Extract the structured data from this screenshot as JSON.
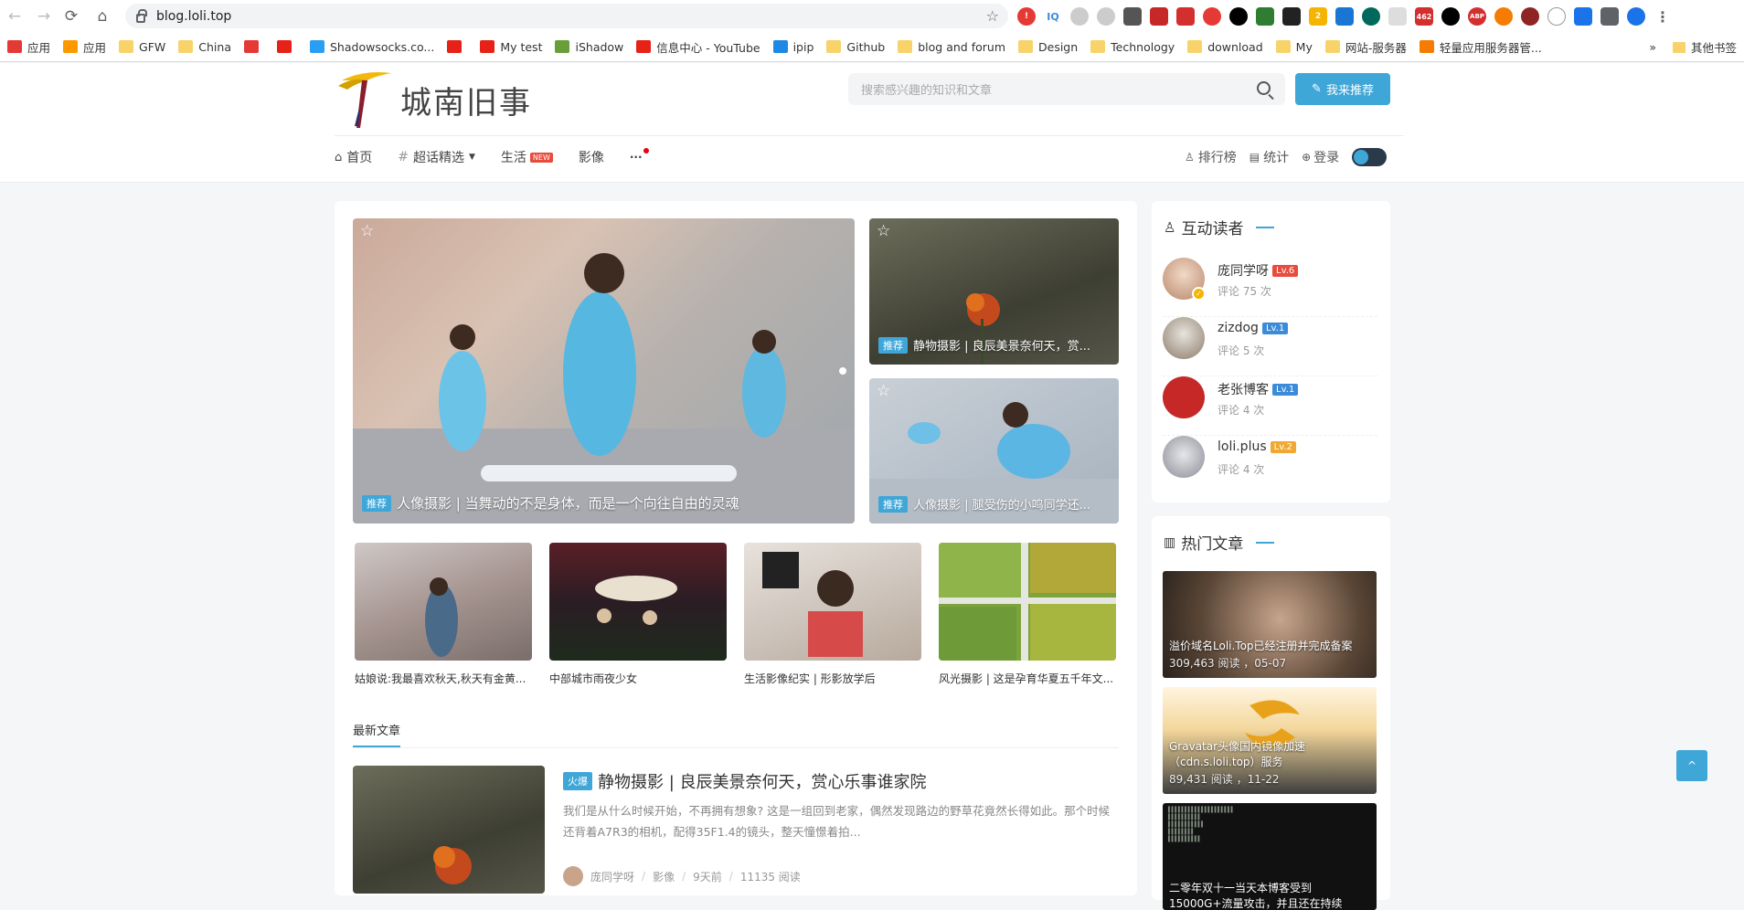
{
  "browser": {
    "url": "blog.loli.top",
    "bookmarks": [
      {
        "label": "应用",
        "icon": "apps-grid-icon"
      },
      {
        "label": "应用",
        "icon": "rainbow-icon"
      },
      {
        "label": "GFW",
        "icon": "folder-icon"
      },
      {
        "label": "China",
        "icon": "folder-icon"
      },
      {
        "label": "",
        "icon": "chart-icon"
      },
      {
        "label": "",
        "icon": "youtube-icon"
      },
      {
        "label": "Shadowsocks.co...",
        "icon": "telegram-icon"
      },
      {
        "label": "",
        "icon": "youtube-icon"
      },
      {
        "label": "My test",
        "icon": "youtube-icon"
      },
      {
        "label": "iShadow",
        "icon": "ishadow-icon"
      },
      {
        "label": "信息中心 - YouTube",
        "icon": "youtube-icon"
      },
      {
        "label": "ipip",
        "icon": "ipip-icon"
      },
      {
        "label": "Github",
        "icon": "folder-icon"
      },
      {
        "label": "blog and forum",
        "icon": "folder-icon"
      },
      {
        "label": "Design",
        "icon": "folder-icon"
      },
      {
        "label": "Technology",
        "icon": "folder-icon"
      },
      {
        "label": "download",
        "icon": "folder-icon"
      },
      {
        "label": "My",
        "icon": "folder-icon"
      },
      {
        "label": "网站-服务器",
        "icon": "folder-icon"
      },
      {
        "label": "轻量应用服务器管...",
        "icon": "bracket-icon"
      }
    ],
    "more_bookmarks": "»",
    "other_bookmarks": "其他书签"
  },
  "site": {
    "logo_text": "城南旧事",
    "search_placeholder": "搜索感兴趣的知识和文章",
    "recommend_button": "我来推荐",
    "nav": [
      {
        "label": "首页",
        "icon": "home-icon"
      },
      {
        "label": "超话精选",
        "icon": "hash-icon",
        "dropdown": true
      },
      {
        "label": "生活",
        "badge": "NEW"
      },
      {
        "label": "影像"
      }
    ],
    "more": "···",
    "right_nav": [
      {
        "label": "排行榜",
        "icon": "rank-icon"
      },
      {
        "label": "统计",
        "icon": "stats-icon"
      },
      {
        "label": "登录",
        "icon": "login-icon"
      }
    ]
  },
  "featured": {
    "main": {
      "tag": "推荐",
      "title": "人像摄影 | 当舞动的不是身体，而是一个向往自由的灵魂"
    },
    "side1": {
      "tag": "推荐",
      "title": "静物摄影 | 良辰美景奈何天，赏..."
    },
    "side2": {
      "tag": "推荐",
      "title": "人像摄影 | 腿受伤的小鸣同学还..."
    }
  },
  "thumbs": [
    {
      "title": "姑娘说:我最喜欢秋天,秋天有金黄..."
    },
    {
      "title": "中部城市雨夜少女"
    },
    {
      "title": "生活影像纪实 | 形影放学后"
    },
    {
      "title": "风光摄影 | 这是孕育华夏五千年文..."
    }
  ],
  "latest": {
    "tab": "最新文章",
    "post": {
      "tag": "火爆",
      "title": "静物摄影 | 良辰美景奈何天，赏心乐事谁家院",
      "excerpt": "我们是从什么时候开始，不再拥有想象? 这是一组回到老家，偶然发现路边的野草花竟然长得如此。那个时候还背着A7R3的相机，配得35F1.4的镜头，整天憧憬着拍...",
      "author": "庞同学呀",
      "category": "影像",
      "time": "9天前",
      "reads": "11135 阅读"
    }
  },
  "sidebar": {
    "readers_title": "互动读者",
    "readers": [
      {
        "name": "庞同学呀",
        "level": "Lv.6",
        "level_color": "#e74c3c",
        "comments": "评论 75 次"
      },
      {
        "name": "zizdog",
        "level": "Lv.1",
        "level_color": "#3b8bd8",
        "comments": "评论 5 次"
      },
      {
        "name": "老张博客",
        "level": "Lv.1",
        "level_color": "#3b8bd8",
        "comments": "评论 4 次"
      },
      {
        "name": "loli.plus",
        "level": "Lv.2",
        "level_color": "#f0a830",
        "comments": "评论 4 次"
      }
    ],
    "hot_title": "热门文章",
    "hot": [
      {
        "title": "溢价域名Loli.Top已经注册并完成备案",
        "meta": "309,463 阅读 ，05-07"
      },
      {
        "title": "Gravatar头像国内镜像加速（cdn.s.loli.top）服务",
        "meta": "89,431 阅读 ，11-22"
      },
      {
        "title": "二零年双十一当天本博客受到15000G+流量攻击，并且还在持续",
        "meta": ""
      }
    ]
  },
  "to_top": "^",
  "colors": {
    "accent": "#3fa6d8",
    "new_badge": "#e74c3c"
  }
}
